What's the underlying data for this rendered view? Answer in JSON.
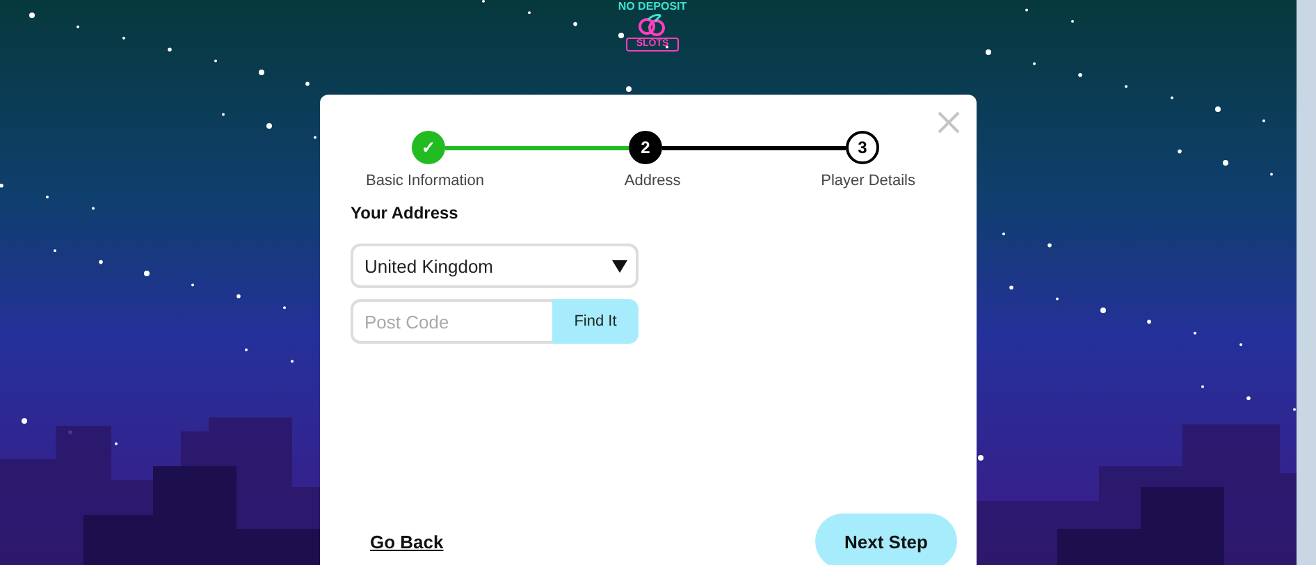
{
  "logo": {
    "top_text": "NO DEPOSIT",
    "ribbon_text": "SLOTS"
  },
  "steps": [
    {
      "marker": "✓",
      "label": "Basic Information",
      "kind": "done"
    },
    {
      "marker": "2",
      "label": "Address",
      "kind": "current"
    },
    {
      "marker": "3",
      "label": "Player Details",
      "kind": "pending"
    }
  ],
  "heading": "Your Address",
  "country_select": {
    "value": "United Kingdom"
  },
  "post_code": {
    "placeholder": "Post Code",
    "button": "Find It"
  },
  "back_link": "Go Back",
  "next_button": "Next Step"
}
